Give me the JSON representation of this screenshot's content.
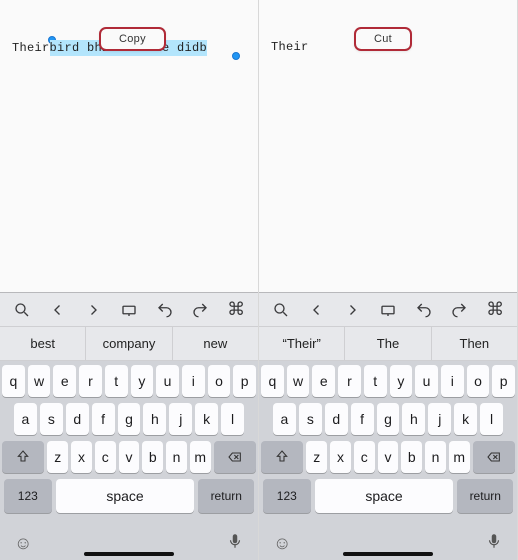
{
  "left": {
    "text": {
      "pre": "Their ",
      "selected": "bird  bhi          ohi she didb"
    },
    "menu": {
      "label": "Copy"
    },
    "suggestions": [
      "best",
      "company",
      "new"
    ]
  },
  "right": {
    "text": {
      "pre": "Their"
    },
    "menu": {
      "label": "Cut"
    },
    "suggestions": [
      "“Their”",
      "The",
      "Then"
    ]
  },
  "keyboard": {
    "row1": [
      "q",
      "w",
      "e",
      "r",
      "t",
      "y",
      "u",
      "i",
      "o",
      "p"
    ],
    "row2": [
      "a",
      "s",
      "d",
      "f",
      "g",
      "h",
      "j",
      "k",
      "l"
    ],
    "row3": [
      "z",
      "x",
      "c",
      "v",
      "b",
      "n",
      "m"
    ],
    "numKey": "123",
    "spaceKey": "space",
    "returnKey": "return"
  },
  "icons": {
    "search": "search-icon",
    "prev": "chevron-left-icon",
    "next": "chevron-right-icon",
    "kbmode": "keyboard-mode-icon",
    "undo": "undo-icon",
    "redo": "redo-icon",
    "cmd": "command-icon",
    "shift": "shift-icon",
    "delete": "delete-icon",
    "emoji": "emoji-icon",
    "mic": "mic-icon"
  }
}
